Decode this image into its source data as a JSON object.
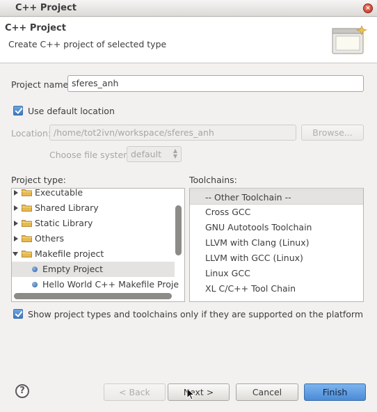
{
  "window": {
    "title": "C++ Project"
  },
  "header": {
    "title": "C++ Project",
    "description": "Create C++ project of selected type"
  },
  "form": {
    "project_name_label": "Project name:",
    "project_name_value": "sferes_anh",
    "use_default_location_label": "Use default location",
    "use_default_location_checked": true,
    "location_label": "Location:",
    "location_value": "/home/tot2ivn/workspace/sferes_anh",
    "browse_label": "Browse...",
    "file_system_label": "Choose file system:",
    "file_system_value": "default"
  },
  "project_type": {
    "label": "Project type:",
    "items": [
      {
        "label": "Executable",
        "kind": "folder",
        "expanded": false
      },
      {
        "label": "Shared Library",
        "kind": "folder",
        "expanded": false
      },
      {
        "label": "Static Library",
        "kind": "folder",
        "expanded": false
      },
      {
        "label": "Others",
        "kind": "folder",
        "expanded": false
      },
      {
        "label": "Makefile project",
        "kind": "folder",
        "expanded": true
      },
      {
        "label": "Empty Project",
        "kind": "leaf",
        "selected": true
      },
      {
        "label": "Hello World C++ Makefile Proje",
        "kind": "leaf",
        "selected": false
      }
    ]
  },
  "toolchains": {
    "label": "Toolchains:",
    "items": [
      {
        "label": "-- Other Toolchain --",
        "selected": true
      },
      {
        "label": "Cross GCC"
      },
      {
        "label": "GNU Autotools Toolchain"
      },
      {
        "label": "LLVM with Clang (Linux)"
      },
      {
        "label": "LLVM with GCC (Linux)"
      },
      {
        "label": "Linux GCC"
      },
      {
        "label": "XL C/C++ Tool Chain"
      }
    ]
  },
  "filter": {
    "label": "Show project types and toolchains only if they are supported on the platform",
    "checked": true
  },
  "buttons": {
    "help": "?",
    "back": "< Back",
    "next": "Next >",
    "cancel": "Cancel",
    "finish": "Finish"
  },
  "colors": {
    "accent": "#4a8bd6",
    "checkbox": "#3b78c1",
    "close": "#c0311d"
  }
}
